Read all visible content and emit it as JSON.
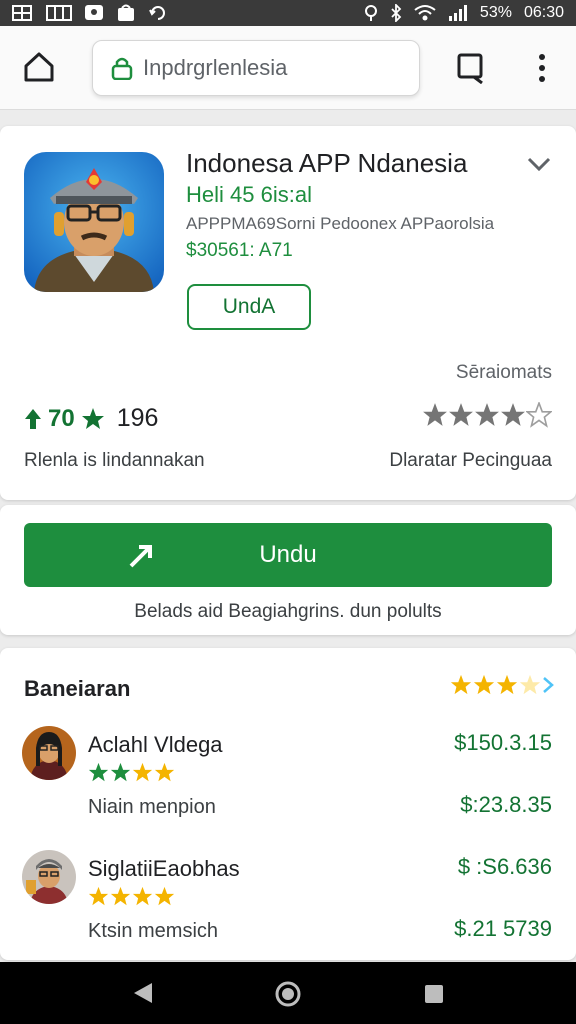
{
  "status_bar": {
    "time": "06:30",
    "battery": "53%",
    "colors": {
      "background": "#3a3a3a",
      "text": "#ffffff"
    }
  },
  "browser": {
    "url": "Inpdrgrlenlesia",
    "icons": [
      "home-icon",
      "lock-icon",
      "bookmark-icon",
      "more-vert-icon"
    ]
  },
  "app": {
    "title": "Indonesa APP Ndanesia",
    "subtitle": "Heli 45 6is:al",
    "meta": "APPPMA69Sorni Pedoonex APPaorolsia",
    "price": "$30561: A71",
    "open_button": "UndA",
    "stats_label": "Sēraiomats",
    "rating_value": "70",
    "rating_count": "196",
    "caption_left": "Rlenla is lindannakan",
    "caption_right": "Dlaratar Pecinguaa",
    "right_rating_stars": 4,
    "accent_color": "#1e8e3e"
  },
  "install": {
    "button_label": "Undu",
    "note": "Belads aid Beagiahgrins. dun polults"
  },
  "reviews": {
    "title": "Baneiaran",
    "header_stars": 3,
    "items": [
      {
        "name": "Aclahl Vldega",
        "stars": 4,
        "text": "Niain menpion",
        "amount_top": "$150.3.15",
        "amount_bottom": "$:23.8.35"
      },
      {
        "name": "SiglatiiEaobhas",
        "stars": 4,
        "text": "Ktsin memsich",
        "amount_top": "$ :S6.636",
        "amount_bottom": "$.21 5739"
      }
    ],
    "star_color": "#f4b400",
    "green_star_color": "#1e8e3e"
  },
  "nav": {
    "icons": [
      "back-icon",
      "home-circle-icon",
      "recents-icon"
    ]
  }
}
